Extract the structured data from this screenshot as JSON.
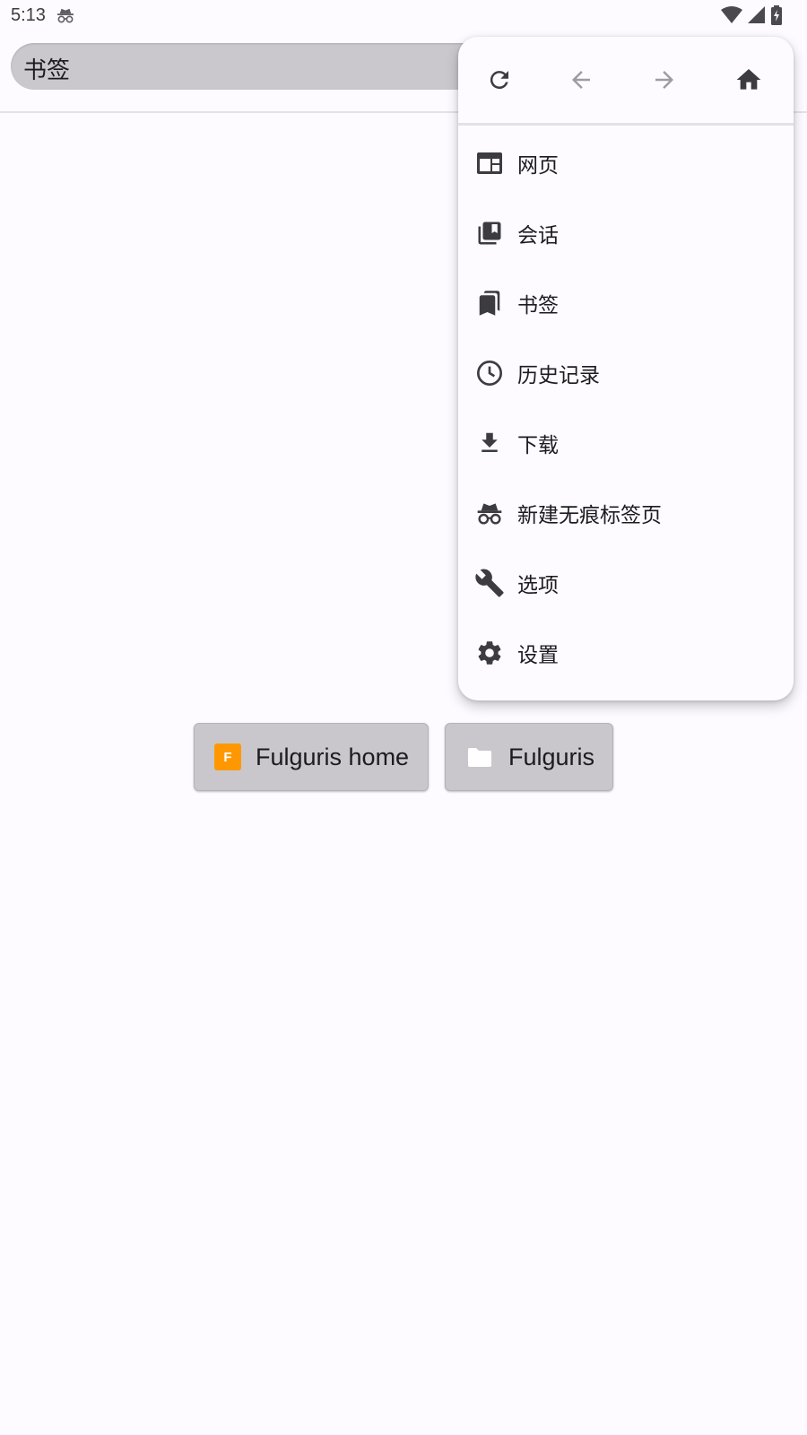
{
  "status_bar": {
    "time": "5:13"
  },
  "topbar": {
    "search_text": "书签"
  },
  "menu": {
    "nav": [
      "reload-icon",
      "back-arrow-icon",
      "forward-arrow-icon",
      "home-icon"
    ],
    "items": [
      {
        "label": "网页",
        "icon": "web-page-icon"
      },
      {
        "label": "会话",
        "icon": "sessions-icon"
      },
      {
        "label": "书签",
        "icon": "bookmarks-icon"
      },
      {
        "label": "历史记录",
        "icon": "history-icon"
      },
      {
        "label": "下载",
        "icon": "download-icon"
      },
      {
        "label": "新建无痕标签页",
        "icon": "incognito-icon"
      },
      {
        "label": "选项",
        "icon": "wrench-icon"
      },
      {
        "label": "设置",
        "icon": "gear-icon"
      }
    ]
  },
  "bookmarks": [
    {
      "label": "Fulguris home",
      "favicon_letter": "F",
      "favicon_color": "#ff9800"
    },
    {
      "label": "Fulguris",
      "icon": "folder-icon"
    }
  ],
  "colors": {
    "icon_dark": "#3c3b40",
    "icon_disabled": "#9e9ca2",
    "chip_bg": "#c9c7cb",
    "background": "#fdfbff"
  }
}
